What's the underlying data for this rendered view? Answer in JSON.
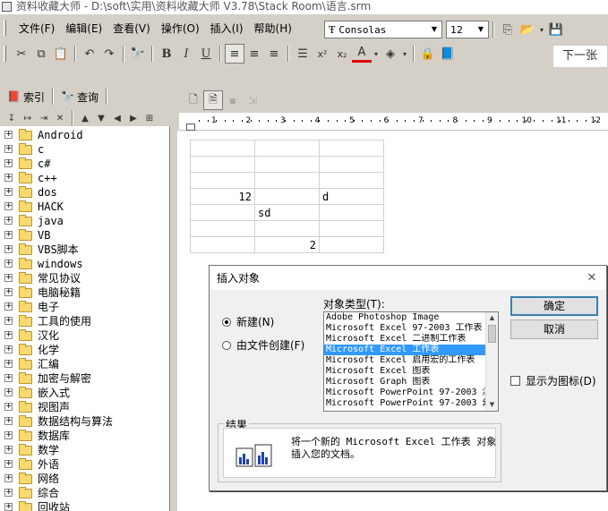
{
  "window": {
    "title": "资料收藏大师 - D:\\soft\\实用\\资料收藏大师 V3.78\\Stack Room\\语言.srm"
  },
  "menu": [
    "文件(F)",
    "编辑(E)",
    "查看(V)",
    "操作(O)",
    "插入(I)",
    "帮助(H)"
  ],
  "format": {
    "font": "Consolas",
    "size": "12",
    "font_icon": "truetype-icon"
  },
  "toolbar": {
    "next_label": "下一张"
  },
  "tabs": {
    "index": "索引",
    "query": "查询"
  },
  "tree_items": [
    "Android",
    "c",
    "c#",
    "c++",
    "dos",
    "HACK",
    "java",
    "VB",
    "VBS脚本",
    "windows",
    "常见协议",
    "电脑秘籍",
    "电子",
    "工具的使用",
    "汉化",
    "化学",
    "汇编",
    "加密与解密",
    "嵌入式",
    "视图声",
    "数据结构与算法",
    "数据库",
    "数学",
    "外语",
    "网络",
    "综合",
    "回收站"
  ],
  "ruler": {
    "labels": [
      "1",
      "2",
      "3",
      "4",
      "5",
      "6",
      "7",
      "8",
      "9",
      "10",
      "11",
      "12"
    ]
  },
  "grid": [
    [
      "",
      "",
      ""
    ],
    [
      "",
      "",
      ""
    ],
    [
      "",
      "",
      ""
    ],
    [
      "12",
      "",
      "d"
    ],
    [
      "",
      "sd",
      ""
    ],
    [
      "",
      "",
      ""
    ],
    [
      "",
      "2",
      ""
    ]
  ],
  "dialog": {
    "title": "插入对象",
    "new_label": "新建(N)",
    "from_file_label": "由文件创建(F)",
    "type_label": "对象类型(T):",
    "object_types": [
      "Adobe Photoshop Image",
      "Microsoft Excel 97-2003 工作表",
      "Microsoft Excel 二进制工作表",
      "Microsoft Excel 工作表",
      "Microsoft Excel 启用宏的工作表",
      "Microsoft Excel 图表",
      "Microsoft Graph 图表",
      "Microsoft PowerPoint 97-2003 演",
      "Microsoft PowerPoint 97-2003 幻"
    ],
    "selected_index": 3,
    "ok": "确定",
    "cancel": "取消",
    "display_icon": "显示为图标(D)",
    "result_label": "结果",
    "result_text": "将一个新的 Microsoft Excel 工作表 对象\n插入您的文档。"
  },
  "colors": {
    "selection": "#3399ff",
    "tree_bg": "#ffffff",
    "app_bg": "#d4d0c8"
  }
}
